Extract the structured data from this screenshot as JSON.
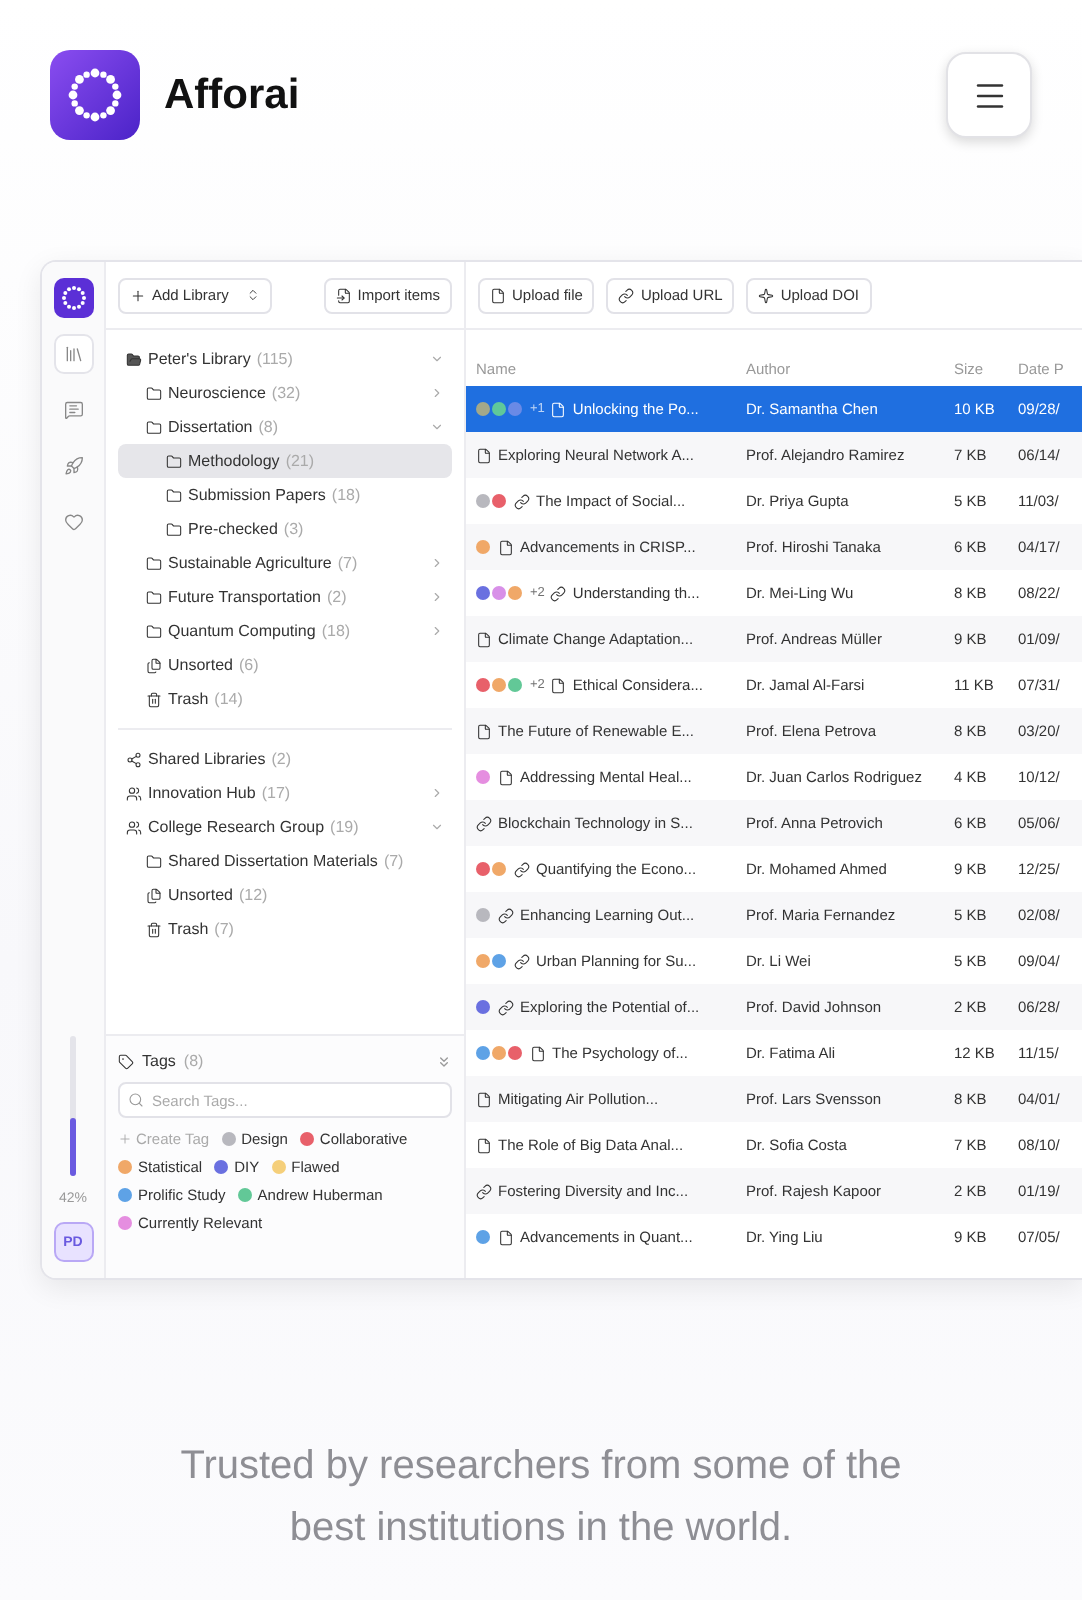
{
  "brand": {
    "name": "Afforai"
  },
  "rail": {
    "items": [
      {
        "kind": "library",
        "selected": true
      },
      {
        "kind": "chat",
        "selected": false
      },
      {
        "kind": "rocket",
        "selected": false
      },
      {
        "kind": "heart",
        "selected": false
      }
    ],
    "usage": {
      "level": 0.42,
      "reading": "42%"
    },
    "avatar": "PD"
  },
  "sidebar": {
    "add_library": "Add Library",
    "import": "Import items",
    "tree": [
      {
        "label": "Peter's Library",
        "count": "(115)",
        "kind": "library",
        "expanded": true,
        "selected": false,
        "children": [
          {
            "label": "Neuroscience",
            "count": "(32)",
            "kind": "folder",
            "expanded": false,
            "selected": false
          },
          {
            "label": "Dissertation",
            "count": "(8)",
            "kind": "folder",
            "expanded": true,
            "selected": false,
            "children": [
              {
                "label": "Methodology",
                "count": "(21)",
                "kind": "folder",
                "selected": true
              },
              {
                "label": "Submission Papers",
                "count": "(18)",
                "kind": "folder",
                "selected": false
              },
              {
                "label": "Pre-checked",
                "count": "(3)",
                "kind": "folder",
                "selected": false
              }
            ]
          },
          {
            "label": "Sustainable Agriculture",
            "count": "(7)",
            "kind": "folder",
            "expanded": false,
            "selected": false
          },
          {
            "label": "Future Transportation",
            "count": "(2)",
            "kind": "folder",
            "expanded": false,
            "selected": false
          },
          {
            "label": "Quantum Computing",
            "count": "(18)",
            "kind": "folder",
            "expanded": false,
            "selected": false
          },
          {
            "label": "Unsorted",
            "count": "(6)",
            "kind": "unsorted",
            "selected": false
          },
          {
            "label": "Trash",
            "count": "(14)",
            "kind": "trash",
            "selected": false
          }
        ]
      }
    ],
    "shared": [
      {
        "label": "Shared Libraries",
        "count": "(2)",
        "kind": "shared",
        "selected": false
      },
      {
        "label": "Innovation Hub",
        "count": "(17)",
        "kind": "group",
        "expanded": false,
        "selected": false
      },
      {
        "label": "College Research Group",
        "count": "(19)",
        "kind": "group",
        "expanded": true,
        "selected": false,
        "children": [
          {
            "label": "Shared Dissertation Materials",
            "count": "(7)",
            "kind": "folder",
            "selected": false
          },
          {
            "label": "Unsorted",
            "count": "(12)",
            "kind": "unsorted",
            "selected": false
          },
          {
            "label": "Trash",
            "count": "(7)",
            "kind": "trash",
            "selected": false
          }
        ]
      }
    ],
    "tags": {
      "title": "Tags",
      "count": "(8)",
      "placeholder": "Search Tags...",
      "create": "Create Tag",
      "items": [
        {
          "name": "Design",
          "color": "#b8b8be"
        },
        {
          "name": "Collaborative",
          "color": "#e8606a"
        },
        {
          "name": "Statistical",
          "color": "#f0a868"
        },
        {
          "name": "DIY",
          "color": "#6a70e0"
        },
        {
          "name": "Flawed",
          "color": "#f5cf7a"
        },
        {
          "name": "Prolific Study",
          "color": "#5ea2e6"
        },
        {
          "name": "Andrew Huberman",
          "color": "#62c897"
        },
        {
          "name": "Currently Relevant",
          "color": "#e58ee0"
        }
      ]
    }
  },
  "main": {
    "toolbar": [
      {
        "kind": "file",
        "label": "Upload file"
      },
      {
        "kind": "link",
        "label": "Upload URL"
      },
      {
        "kind": "doi",
        "label": "Upload DOI"
      }
    ]
  },
  "table": {
    "columns": [
      "Name",
      "Author",
      "Size",
      "Date P"
    ],
    "rows": [
      {
        "tags": [
          {
            "color": "#a3a889"
          },
          {
            "color": "#5fc89a"
          },
          {
            "color": "#6a8ae6"
          }
        ],
        "extra": "+1",
        "kind": "file",
        "name": "Unlocking the Po...",
        "author": "Dr. Samantha Chen",
        "size": "10 KB",
        "date": "09/28/",
        "selected": true
      },
      {
        "tags": [],
        "kind": "file",
        "name": "Exploring Neural Network A...",
        "author": "Prof. Alejandro Ramirez",
        "size": "7 KB",
        "date": "06/14/",
        "selected": false
      },
      {
        "tags": [
          {
            "color": "#b8b8be"
          },
          {
            "color": "#e8606a"
          }
        ],
        "kind": "link",
        "name": "The Impact of Social...",
        "author": "Dr. Priya Gupta",
        "size": "5 KB",
        "date": "11/03/",
        "selected": false
      },
      {
        "tags": [
          {
            "color": "#f0a868"
          }
        ],
        "kind": "file",
        "name": "Advancements in CRISP...",
        "author": "Prof. Hiroshi Tanaka",
        "size": "6 KB",
        "date": "04/17/",
        "selected": false
      },
      {
        "tags": [
          {
            "color": "#6a70e0"
          },
          {
            "color": "#d890e8"
          },
          {
            "color": "#f0a868"
          }
        ],
        "extra": "+2",
        "kind": "link",
        "name": "Understanding th...",
        "author": "Dr. Mei-Ling Wu",
        "size": "8 KB",
        "date": "08/22/",
        "selected": false
      },
      {
        "tags": [],
        "kind": "file",
        "name": "Climate Change Adaptation...",
        "author": "Prof. Andreas Müller",
        "size": "9 KB",
        "date": "01/09/",
        "selected": false
      },
      {
        "tags": [
          {
            "color": "#e8606a"
          },
          {
            "color": "#f0a868"
          },
          {
            "color": "#62c897"
          }
        ],
        "extra": "+2",
        "kind": "file",
        "name": "Ethical Considera...",
        "author": "Dr. Jamal Al-Farsi",
        "size": "11 KB",
        "date": "07/31/",
        "selected": false
      },
      {
        "tags": [],
        "kind": "file",
        "name": "The Future of Renewable E...",
        "author": "Prof. Elena Petrova",
        "size": "8 KB",
        "date": "03/20/",
        "selected": false
      },
      {
        "tags": [
          {
            "color": "#e58ee0"
          }
        ],
        "kind": "file",
        "name": "Addressing Mental Heal...",
        "author": "Dr. Juan Carlos Rodriguez",
        "size": "4 KB",
        "date": "10/12/",
        "selected": false
      },
      {
        "tags": [],
        "kind": "link",
        "name": "Blockchain Technology in S...",
        "author": "Prof. Anna Petrovich",
        "size": "6 KB",
        "date": "05/06/",
        "selected": false
      },
      {
        "tags": [
          {
            "color": "#e8606a"
          },
          {
            "color": "#f0a868"
          }
        ],
        "kind": "link",
        "name": "Quantifying the Econo...",
        "author": "Dr. Mohamed Ahmed",
        "size": "9 KB",
        "date": "12/25/",
        "selected": false
      },
      {
        "tags": [
          {
            "color": "#b8b8be"
          }
        ],
        "kind": "link",
        "name": "Enhancing Learning Out...",
        "author": "Prof. Maria Fernandez",
        "size": "5 KB",
        "date": "02/08/",
        "selected": false
      },
      {
        "tags": [
          {
            "color": "#f0a868"
          },
          {
            "color": "#5ea2e6"
          }
        ],
        "kind": "link",
        "name": "Urban Planning for Su...",
        "author": "Dr. Li Wei",
        "size": "5 KB",
        "date": "09/04/",
        "selected": false
      },
      {
        "tags": [
          {
            "color": "#6a70e0"
          }
        ],
        "kind": "link",
        "name": "Exploring the Potential of...",
        "author": "Prof. David Johnson",
        "size": "2 KB",
        "date": "06/28/",
        "selected": false
      },
      {
        "tags": [
          {
            "color": "#5ea2e6"
          },
          {
            "color": "#f0a868"
          },
          {
            "color": "#e8606a"
          }
        ],
        "kind": "file",
        "name": "The Psychology of...",
        "author": "Dr. Fatima Ali",
        "size": "12 KB",
        "date": "11/15/",
        "selected": false
      },
      {
        "tags": [],
        "kind": "file",
        "name": "Mitigating Air Pollution...",
        "author": "Prof. Lars Svensson",
        "size": "8 KB",
        "date": "04/01/",
        "selected": false
      },
      {
        "tags": [],
        "kind": "file",
        "name": "The Role of Big Data Anal...",
        "author": "Dr. Sofia Costa",
        "size": "7 KB",
        "date": "08/10/",
        "selected": false
      },
      {
        "tags": [],
        "kind": "link",
        "name": "Fostering Diversity and Inc...",
        "author": "Prof. Rajesh Kapoor",
        "size": "2 KB",
        "date": "01/19/",
        "selected": false
      },
      {
        "tags": [
          {
            "color": "#5ea2e6"
          }
        ],
        "kind": "file",
        "name": "Advancements in Quant...",
        "author": "Dr. Ying Liu",
        "size": "9 KB",
        "date": "07/05/",
        "selected": false
      }
    ]
  },
  "tagline": "Trusted by researchers from some of the best institutions in the world."
}
